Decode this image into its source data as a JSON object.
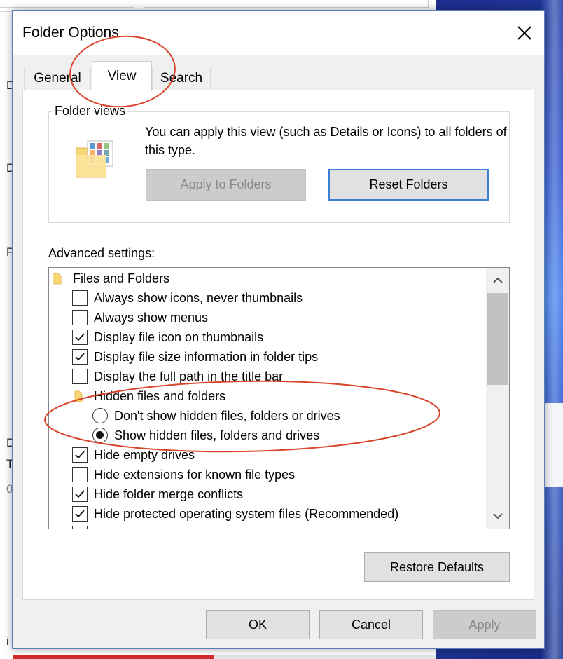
{
  "dialog": {
    "title": "Folder Options",
    "close_label": "close"
  },
  "tabs": [
    {
      "label": "General",
      "selected": false
    },
    {
      "label": "View",
      "selected": true
    },
    {
      "label": "Search",
      "selected": false
    }
  ],
  "folder_views": {
    "title": "Folder views",
    "description": "You can apply this view (such as Details or Icons) to all folders of this type.",
    "apply_button": "Apply to Folders",
    "reset_button": "Reset Folders"
  },
  "advanced": {
    "label": "Advanced settings:",
    "items": [
      {
        "type": "folder",
        "label": "Files and Folders"
      },
      {
        "type": "checkbox",
        "label": "Always show icons, never thumbnails",
        "checked": false
      },
      {
        "type": "checkbox",
        "label": "Always show menus",
        "checked": false
      },
      {
        "type": "checkbox",
        "label": "Display file icon on thumbnails",
        "checked": true
      },
      {
        "type": "checkbox",
        "label": "Display file size information in folder tips",
        "checked": true
      },
      {
        "type": "checkbox",
        "label": "Display the full path in the title bar",
        "checked": false
      },
      {
        "type": "folder",
        "label": "Hidden files and folders"
      },
      {
        "type": "radio",
        "label": "Don't show hidden files, folders or drives",
        "checked": false
      },
      {
        "type": "radio",
        "label": "Show hidden files, folders and drives",
        "checked": true
      },
      {
        "type": "checkbox",
        "label": "Hide empty drives",
        "checked": true
      },
      {
        "type": "checkbox",
        "label": "Hide extensions for known file types",
        "checked": false
      },
      {
        "type": "checkbox",
        "label": "Hide folder merge conflicts",
        "checked": true
      },
      {
        "type": "checkbox",
        "label": "Hide protected operating system files (Recommended)",
        "checked": true
      }
    ]
  },
  "buttons": {
    "restore_defaults": "Restore Defaults",
    "ok": "OK",
    "cancel": "Cancel",
    "apply": "Apply"
  },
  "background": {
    "left_letters": [
      "D",
      "D",
      "P",
      "D",
      "T",
      "0",
      "i"
    ]
  },
  "colors": {
    "annotation": "#d9452b",
    "accent": "#3c7fd9",
    "window_bg": "#f0f0f0"
  }
}
